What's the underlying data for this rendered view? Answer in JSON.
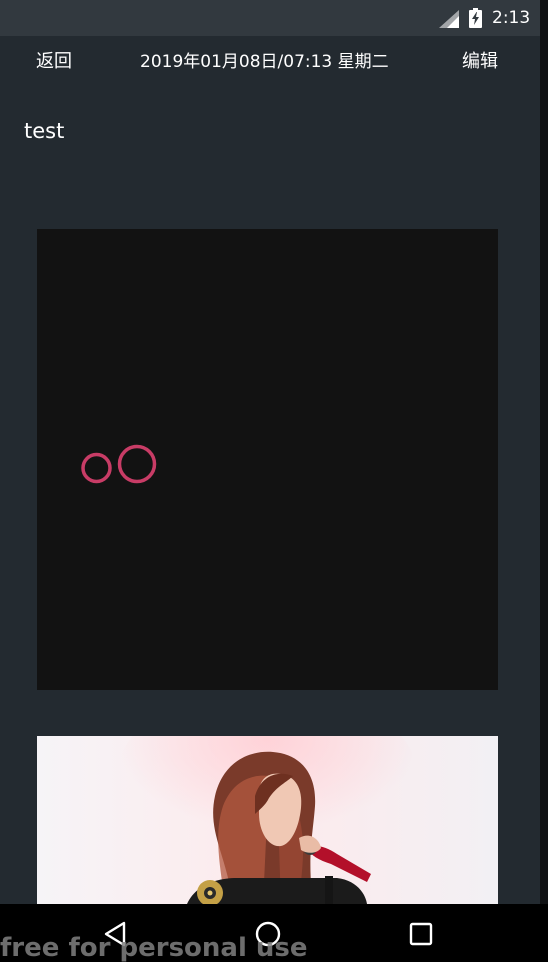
{
  "status_bar": {
    "time": "2:13",
    "signal_icon": "cell-signal-icon",
    "battery_icon": "battery-charging-icon"
  },
  "toolbar": {
    "back_label": "返回",
    "date_label": "2019年01月08日/07:13 星期二",
    "edit_label": "编辑"
  },
  "note": {
    "title": "test"
  },
  "nav_bar": {
    "back_icon": "triangle-back-icon",
    "home_icon": "circle-home-icon",
    "recents_icon": "square-recents-icon"
  },
  "watermark": "free for personal use",
  "colors": {
    "status_bar": "#32393f",
    "app_background": "#232a30",
    "image_background": "#121212",
    "drawing_stroke": "#c83c66",
    "nav_bar": "#000000"
  }
}
